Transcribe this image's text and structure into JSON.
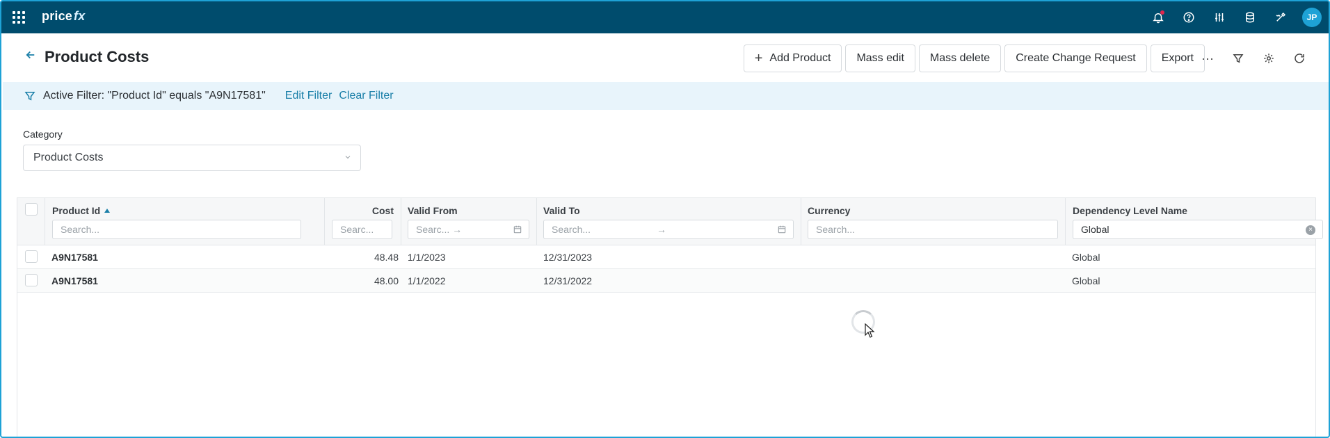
{
  "app": {
    "brand_main": "price",
    "brand_suffix": "fx",
    "avatar_initials": "JP"
  },
  "topbar_icons": [
    "notifications-bell-icon",
    "help-icon",
    "settings-sliders-icon",
    "database-icon",
    "tools-icon"
  ],
  "header": {
    "title": "Product Costs",
    "buttons": {
      "add_product": "Add Product",
      "mass_edit": "Mass edit",
      "mass_delete": "Mass delete",
      "create_change_request": "Create Change Request",
      "export": "Export",
      "more": "···"
    }
  },
  "filter": {
    "text": "Active Filter: \"Product Id\" equals \"A9N17581\"",
    "edit_label": "Edit Filter",
    "clear_label": "Clear Filter"
  },
  "category": {
    "label": "Category",
    "value": "Product Costs"
  },
  "grid": {
    "columns": {
      "product_id": {
        "title": "Product Id",
        "placeholder": "Search..."
      },
      "cost": {
        "title": "Cost",
        "placeholder": "Searc..."
      },
      "valid_from": {
        "title": "Valid From",
        "placeholder": "Searc... →"
      },
      "valid_to": {
        "title": "Valid To",
        "placeholder": "Search...",
        "arrow": "→"
      },
      "currency": {
        "title": "Currency",
        "placeholder": "Search..."
      },
      "dependency_level": {
        "title": "Dependency Level Name",
        "value": "Global"
      }
    },
    "rows": [
      {
        "product_id": "A9N17581",
        "cost": "48.48",
        "valid_from": "1/1/2023",
        "valid_to": "12/31/2023",
        "currency": "",
        "dependency_level": "Global"
      },
      {
        "product_id": "A9N17581",
        "cost": "48.00",
        "valid_from": "1/1/2022",
        "valid_to": "12/31/2022",
        "currency": "",
        "dependency_level": "Global"
      }
    ]
  },
  "colors": {
    "topbar": "#004c6d",
    "accent": "#1ea2d6",
    "link": "#1a7fa8",
    "filter_bg": "#e8f4fb"
  }
}
